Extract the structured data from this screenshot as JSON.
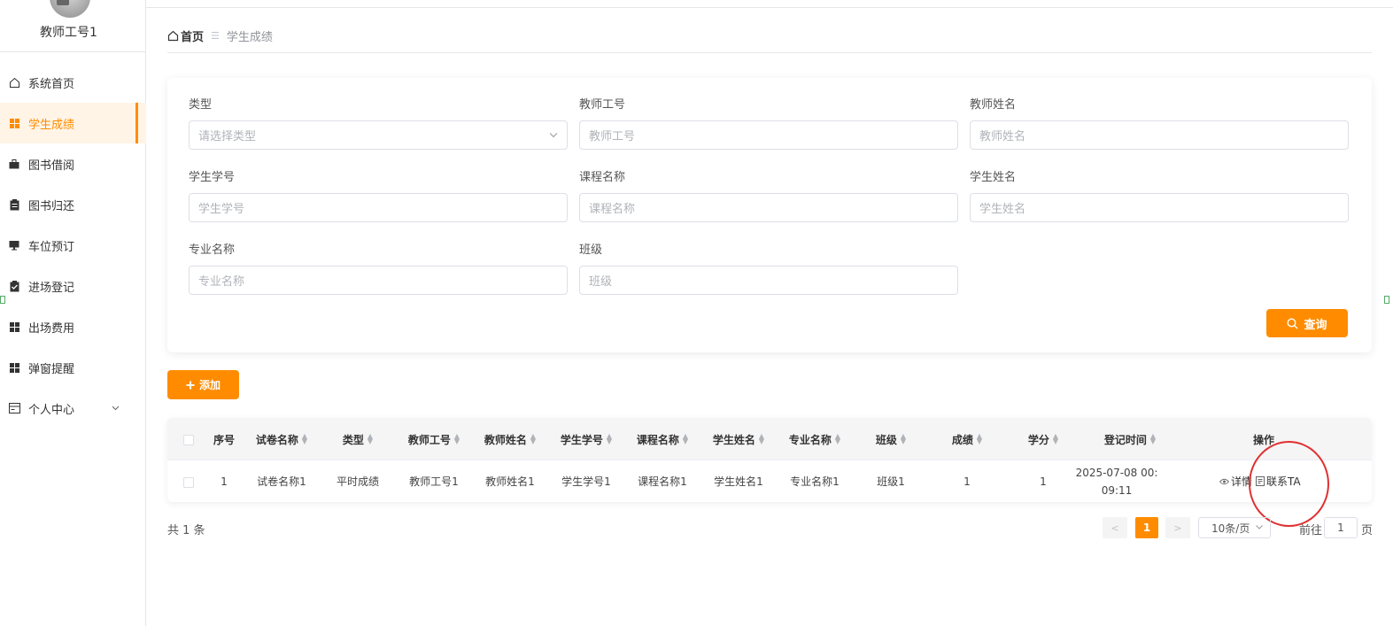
{
  "sidebar": {
    "username": "教师工号1",
    "items": [
      {
        "label": "系统首页",
        "icon": "home-icon"
      },
      {
        "label": "学生成绩",
        "icon": "grid-icon",
        "active": true
      },
      {
        "label": "图书借阅",
        "icon": "briefcase-icon"
      },
      {
        "label": "图书归还",
        "icon": "clipboard-icon"
      },
      {
        "label": "车位预订",
        "icon": "monitor-icon"
      },
      {
        "label": "进场登记",
        "icon": "clipboard-check-icon"
      },
      {
        "label": "出场费用",
        "icon": "grid-icon"
      },
      {
        "label": "弹窗提醒",
        "icon": "grid-icon"
      },
      {
        "label": "个人中心",
        "icon": "card-icon",
        "expandable": true
      }
    ]
  },
  "breadcrumb": {
    "home": "首页",
    "current": "学生成绩"
  },
  "search": {
    "fields": [
      {
        "label": "类型",
        "placeholder": "请选择类型",
        "type": "select"
      },
      {
        "label": "教师工号",
        "placeholder": "教师工号"
      },
      {
        "label": "教师姓名",
        "placeholder": "教师姓名"
      },
      {
        "label": "学生学号",
        "placeholder": "学生学号"
      },
      {
        "label": "课程名称",
        "placeholder": "课程名称"
      },
      {
        "label": "学生姓名",
        "placeholder": "学生姓名"
      },
      {
        "label": "专业名称",
        "placeholder": "专业名称"
      },
      {
        "label": "班级",
        "placeholder": "班级"
      }
    ],
    "query_label": "查询"
  },
  "add_label": "添加",
  "table": {
    "headers": [
      "序号",
      "试卷名称",
      "类型",
      "教师工号",
      "教师姓名",
      "学生学号",
      "课程名称",
      "学生姓名",
      "专业名称",
      "班级",
      "成绩",
      "学分",
      "登记时间",
      "操作"
    ],
    "rows": [
      {
        "cells": [
          "1",
          "试卷名称1",
          "平时成绩",
          "教师工号1",
          "教师姓名1",
          "学生学号1",
          "课程名称1",
          "学生姓名1",
          "专业名称1",
          "班级1",
          "1",
          "1"
        ],
        "time_line1": "2025-07-08 00:",
        "time_line2": "09:11",
        "ops": {
          "detail": "详情",
          "contact": "联系TA"
        }
      }
    ]
  },
  "pagination": {
    "total": "共 1 条",
    "prev": "<",
    "page": "1",
    "next": ">",
    "page_size": "10条/页",
    "goto_prefix": "前往",
    "goto_value": "1",
    "goto_suffix": "页"
  },
  "colors": {
    "accent": "#ff8c00",
    "annotation": "#e03030"
  }
}
